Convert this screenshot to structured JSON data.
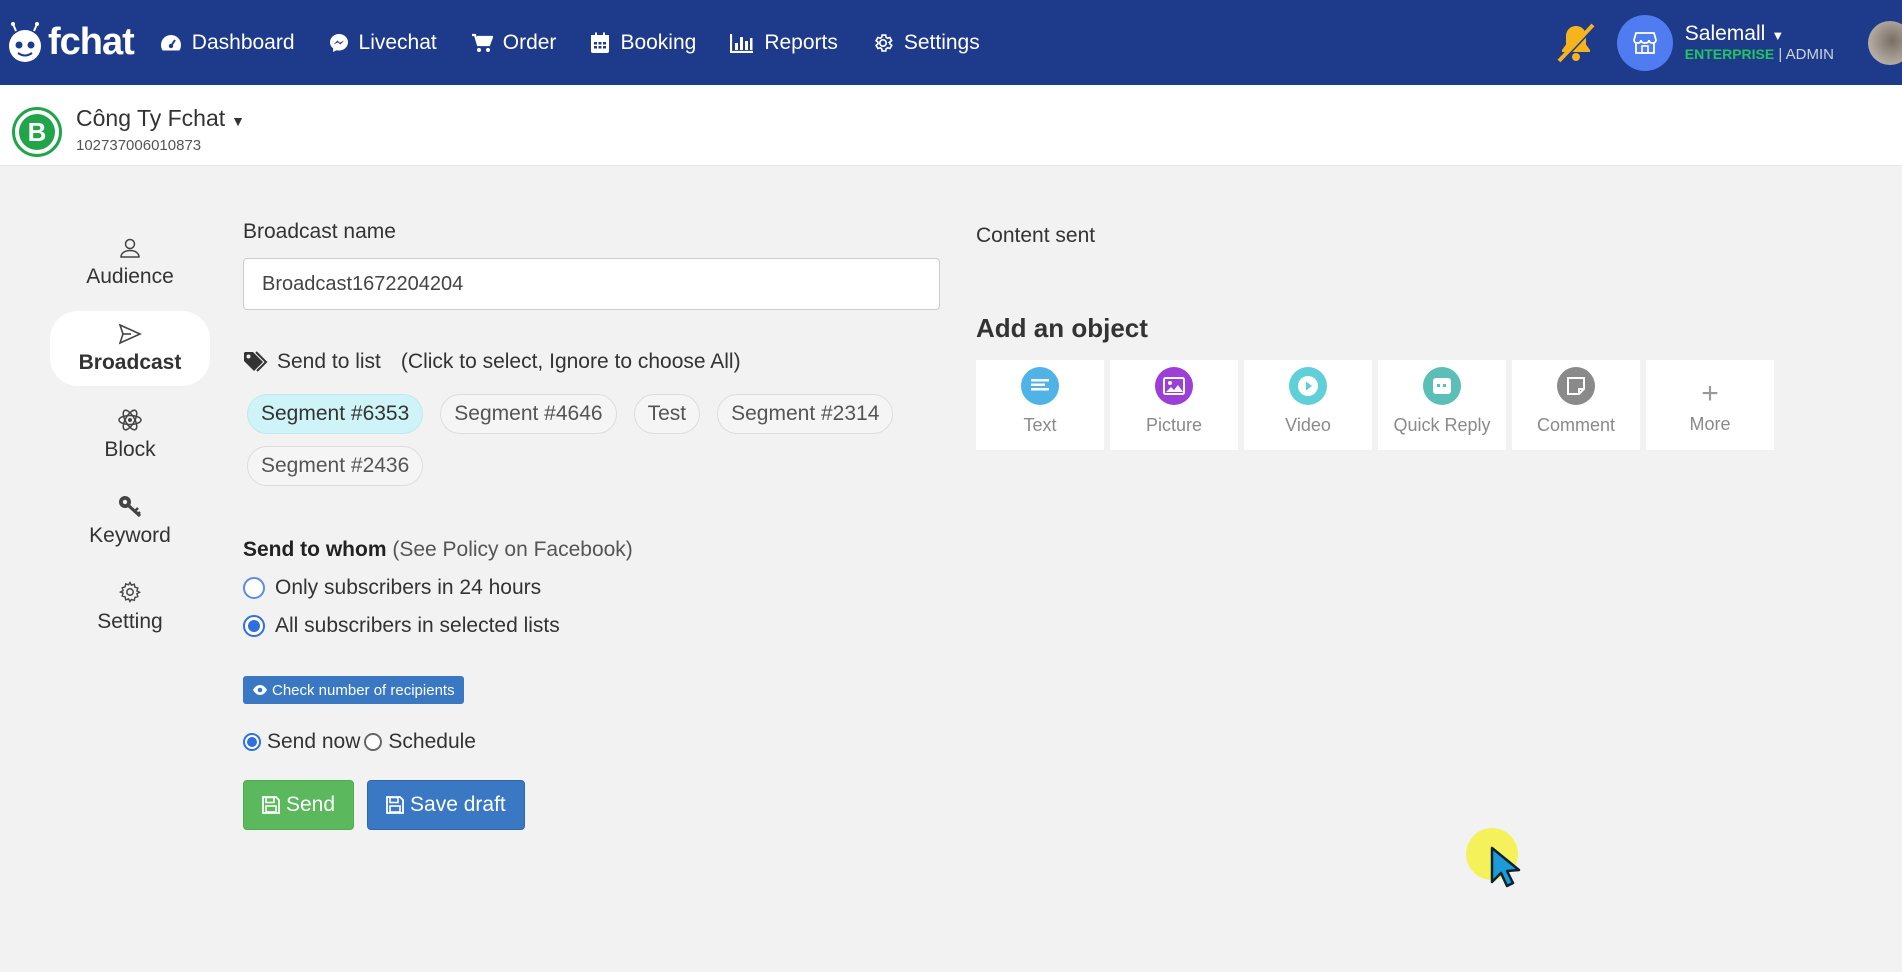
{
  "brand": {
    "name": "fchat"
  },
  "nav": {
    "items": [
      {
        "label": "Dashboard",
        "icon": "dashboard-icon"
      },
      {
        "label": "Livechat",
        "icon": "chat-icon"
      },
      {
        "label": "Order",
        "icon": "cart-icon"
      },
      {
        "label": "Booking",
        "icon": "calendar-icon"
      },
      {
        "label": "Reports",
        "icon": "bar-chart-icon"
      },
      {
        "label": "Settings",
        "icon": "gear-icon"
      }
    ]
  },
  "account": {
    "name": "Salemall",
    "plan": "ENTERPRISE",
    "separator": "|",
    "role": "ADMIN"
  },
  "page": {
    "name": "Công Ty Fchat",
    "id": "102737006010873",
    "avatar_letter": "B"
  },
  "leftmenu": {
    "items": [
      {
        "label": "Audience",
        "icon": "user-icon"
      },
      {
        "label": "Broadcast",
        "icon": "send-icon",
        "active": true
      },
      {
        "label": "Block",
        "icon": "atom-icon"
      },
      {
        "label": "Keyword",
        "icon": "key-icon"
      },
      {
        "label": "Setting",
        "icon": "gear-icon"
      }
    ]
  },
  "form": {
    "broadcast_name_label": "Broadcast name",
    "broadcast_name_value": "Broadcast1672204204",
    "send_to_list_label": "Send to list",
    "send_to_list_hint": "(Click to select, Ignore to choose All)",
    "segments": [
      {
        "label": "Segment #6353",
        "selected": true
      },
      {
        "label": "Segment #4646",
        "selected": false
      },
      {
        "label": "Test",
        "selected": false
      },
      {
        "label": "Segment #2314",
        "selected": false
      },
      {
        "label": "Segment #2436",
        "selected": false
      }
    ],
    "send_to_whom_label": "Send to whom",
    "policy_text": "(See Policy on Facebook)",
    "option_24h": "Only subscribers in 24 hours",
    "option_all": "All subscribers in selected lists",
    "check_recipients": "Check number of recipients",
    "send_now": "Send now",
    "schedule": "Schedule",
    "send_button": "Send",
    "save_draft_button": "Save draft"
  },
  "content": {
    "content_sent_label": "Content sent",
    "add_object_title": "Add an object",
    "objects": [
      {
        "label": "Text",
        "color": "#4fb3e8",
        "icon": "text-icon"
      },
      {
        "label": "Picture",
        "color": "#9b3fd6",
        "icon": "image-icon"
      },
      {
        "label": "Video",
        "color": "#5fd0d8",
        "icon": "play-icon"
      },
      {
        "label": "Quick Reply",
        "color": "#5bbfb8",
        "icon": "quick-reply-icon"
      },
      {
        "label": "Comment",
        "color": "#8a8a8a",
        "icon": "comment-icon"
      }
    ],
    "more_label": "More"
  },
  "colors": {
    "nav_bg": "#1e3a8a",
    "send": "#5cb85c",
    "primary": "#3a78c3",
    "selected_chip": "#cff4f8"
  }
}
